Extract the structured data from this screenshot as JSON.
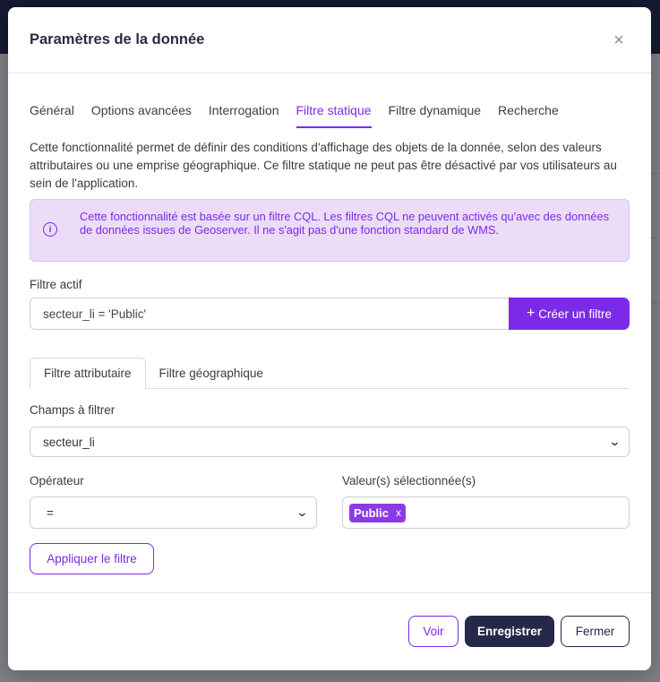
{
  "modal": {
    "title": "Paramètres de la donnée",
    "close_symbol": "×"
  },
  "tabs": [
    {
      "label": "Général",
      "active": false
    },
    {
      "label": "Options avancées",
      "active": false
    },
    {
      "label": "Interrogation",
      "active": false
    },
    {
      "label": "Filtre statique",
      "active": true
    },
    {
      "label": "Filtre dynamique",
      "active": false
    },
    {
      "label": "Recherche",
      "active": false
    }
  ],
  "description": "Cette fonctionnalité permet de définir des conditions d'affichage des objets de la donnée, selon des valeurs attributaires ou une emprise géographique. Ce filtre statique ne peut pas être désactivé par vos utilisateurs au sein de l'application.",
  "alert": {
    "icon": "info-icon",
    "icon_glyph": "i",
    "text": "Cette fonctionnalité est basée sur un filtre CQL. Les filtres CQL ne peuvent activés qu'avec des données de données issues de Geoserver. Il ne s'agit pas d'une fonction standard de WMS."
  },
  "active_filter": {
    "label": "Filtre actif",
    "value": "secteur_li = 'Public'",
    "create_button": "Créer un filtre",
    "create_icon": "+"
  },
  "subtabs": [
    {
      "label": "Filtre attributaire",
      "active": true
    },
    {
      "label": "Filtre géographique",
      "active": false
    }
  ],
  "field": {
    "label": "Champs à filtrer",
    "selected": "secteur_li"
  },
  "operator": {
    "label": "Opérateur",
    "selected": "="
  },
  "values": {
    "label": "Valeur(s) sélectionnée(s)",
    "tags": [
      "Public"
    ],
    "remove_symbol": "x"
  },
  "apply_button": "Appliquer le filtre",
  "footer": {
    "voir": "Voir",
    "save": "Enregistrer",
    "close": "Fermer"
  },
  "colors": {
    "accent": "#7c2ae8",
    "dark": "#262849",
    "alert_bg": "#ecdcf8"
  }
}
